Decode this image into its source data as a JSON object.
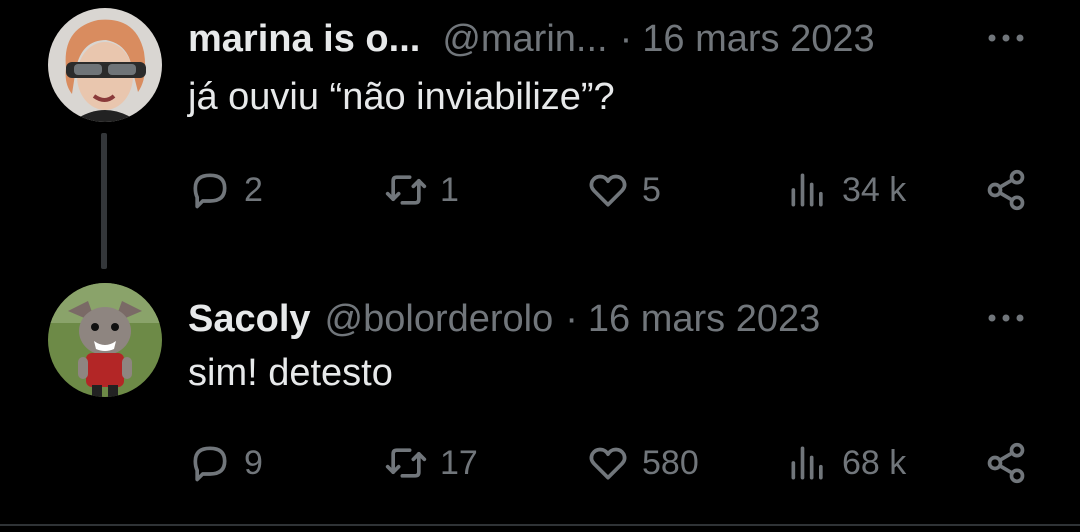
{
  "tweets": [
    {
      "name": "marina is o...",
      "handle": "@marin...",
      "separator": "·",
      "date": "16 mars 2023",
      "text": "já ouviu “não inviabilize”?",
      "replies": "2",
      "retweets": "1",
      "likes": "5",
      "views": "34 k"
    },
    {
      "name": "Sacoly",
      "handle": "@bolorderolo",
      "separator": "·",
      "date": "16 mars 2023",
      "text": "sim! detesto",
      "replies": "9",
      "retweets": "17",
      "likes": "580",
      "views": "68 k"
    }
  ],
  "colors": {
    "background": "#000000",
    "primary_text": "#e7e9ea",
    "secondary_text": "#71767b",
    "thread_line": "#333639"
  },
  "icons": [
    "reply-icon",
    "retweet-icon",
    "like-icon",
    "views-icon",
    "share-icon",
    "more-icon"
  ]
}
